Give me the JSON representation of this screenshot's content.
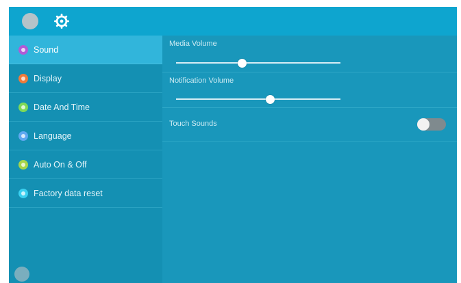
{
  "topbar": {
    "icons": [
      "home-icon",
      "settings-gear-icon"
    ],
    "gear_color": "#ffffff"
  },
  "sidebar": {
    "items": [
      {
        "label": "Sound",
        "icon": "sound-icon",
        "color": "#b05bd6",
        "active": true
      },
      {
        "label": "Display",
        "icon": "display-icon",
        "color": "#f07b3a",
        "active": false
      },
      {
        "label": "Date And Time",
        "icon": "clock-icon",
        "color": "#7ed957",
        "active": false
      },
      {
        "label": "Language",
        "icon": "language-icon",
        "color": "#5fa8f0",
        "active": false
      },
      {
        "label": "Auto On & Off",
        "icon": "power-schedule-icon",
        "color": "#a6d64a",
        "active": false
      },
      {
        "label": "Factory data reset",
        "icon": "reset-icon",
        "color": "#3ad0f0",
        "active": false
      }
    ],
    "bottom_icon": "settings-icon"
  },
  "content": {
    "media_volume": {
      "label": "Media Volume",
      "value": 0.4
    },
    "notification_volume": {
      "label": "Notification Volume",
      "value": 0.57
    },
    "touch_sounds": {
      "label": "Touch Sounds",
      "on": false
    }
  },
  "colors": {
    "topbar": "#0ea5cf",
    "sidebar": "#1490b3",
    "sidebar_active": "#31b5db",
    "content": "#1997bb"
  }
}
